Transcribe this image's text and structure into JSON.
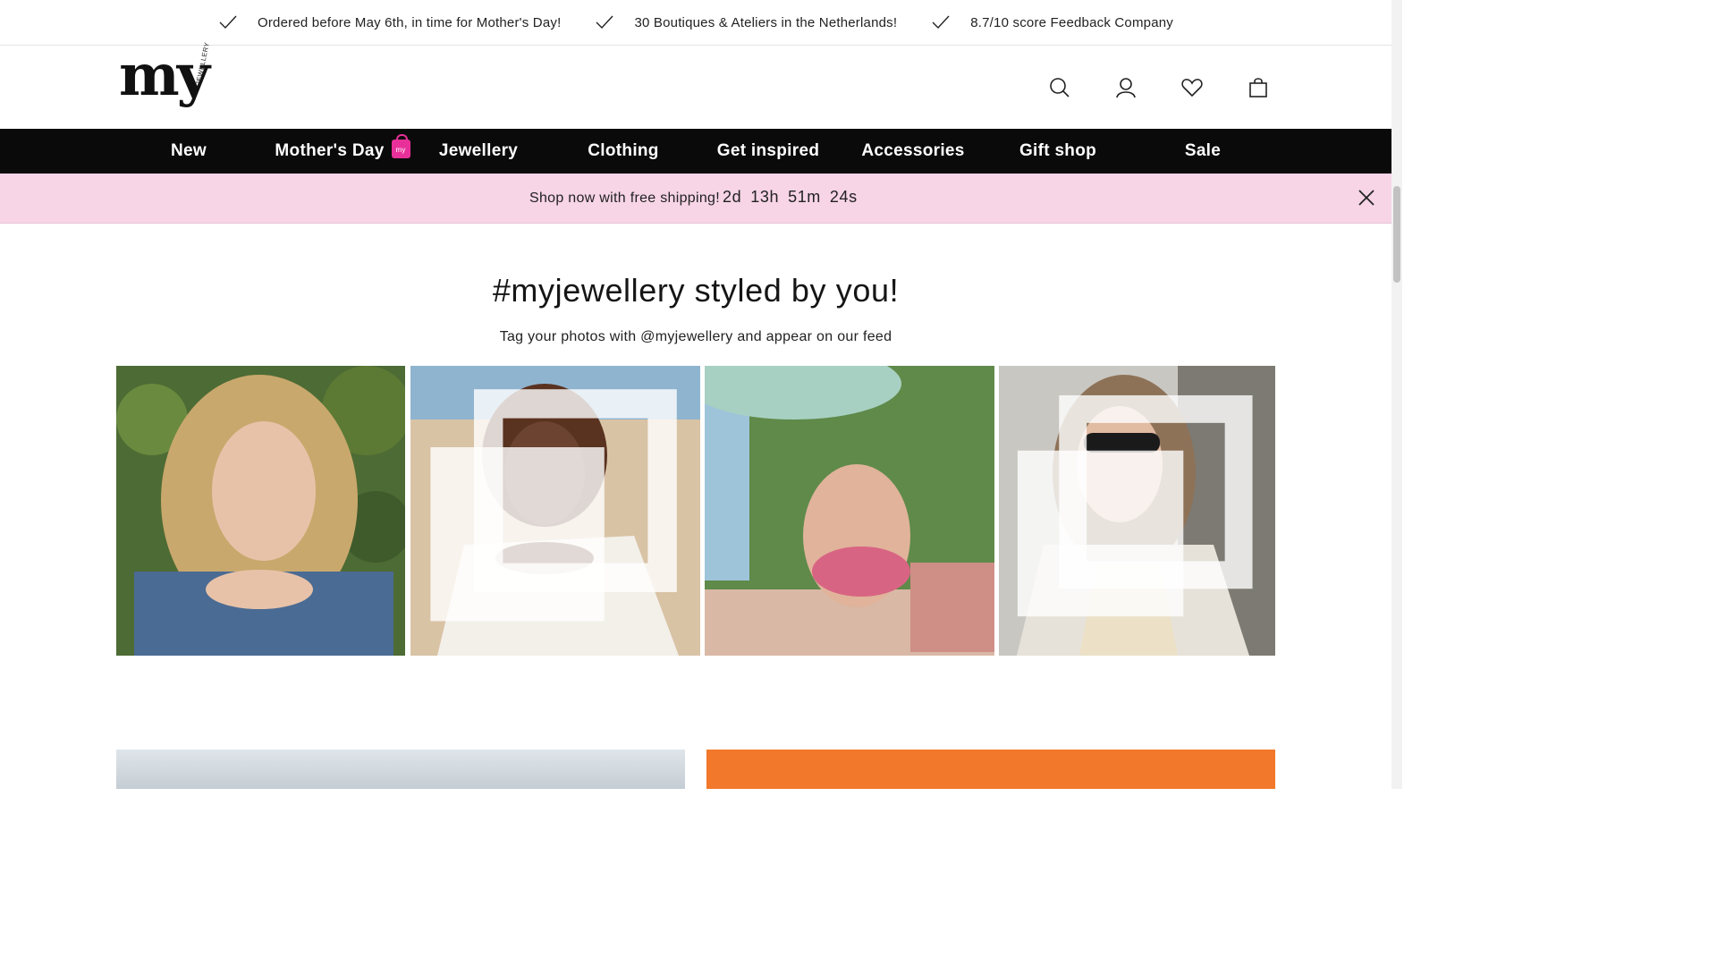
{
  "usp": [
    {
      "icon": "check-icon",
      "text": "Ordered before May 6th, in time for Mother's Day!"
    },
    {
      "icon": "check-icon",
      "text": "30 Boutiques & Ateliers in the Netherlands!"
    },
    {
      "icon": "check-icon",
      "text": "8.7/10 score Feedback Company"
    }
  ],
  "logo": {
    "main": "my",
    "sub": "JEWELLERY"
  },
  "header_icons": [
    "search-icon",
    "account-icon",
    "wishlist-heart-icon",
    "shopping-bag-icon"
  ],
  "nav": {
    "items": [
      "New",
      "Mother's Day",
      "Jewellery",
      "Clothing",
      "Get inspired",
      "Accessories",
      "Gift shop",
      "Sale"
    ],
    "badge_text": "my"
  },
  "promo": {
    "text": "Shop now with free shipping!",
    "countdown": {
      "days": "2d",
      "hours": "13h",
      "minutes": "51m",
      "seconds": "24s"
    }
  },
  "section": {
    "title": "#myjewellery styled by you!",
    "subtitle": "Tag your photos with @myjewellery and appear on our feed"
  },
  "colors": {
    "nav_bg": "#0a0a0a",
    "promo_bg": "#f7d4e6",
    "badge": "#e8309a"
  }
}
